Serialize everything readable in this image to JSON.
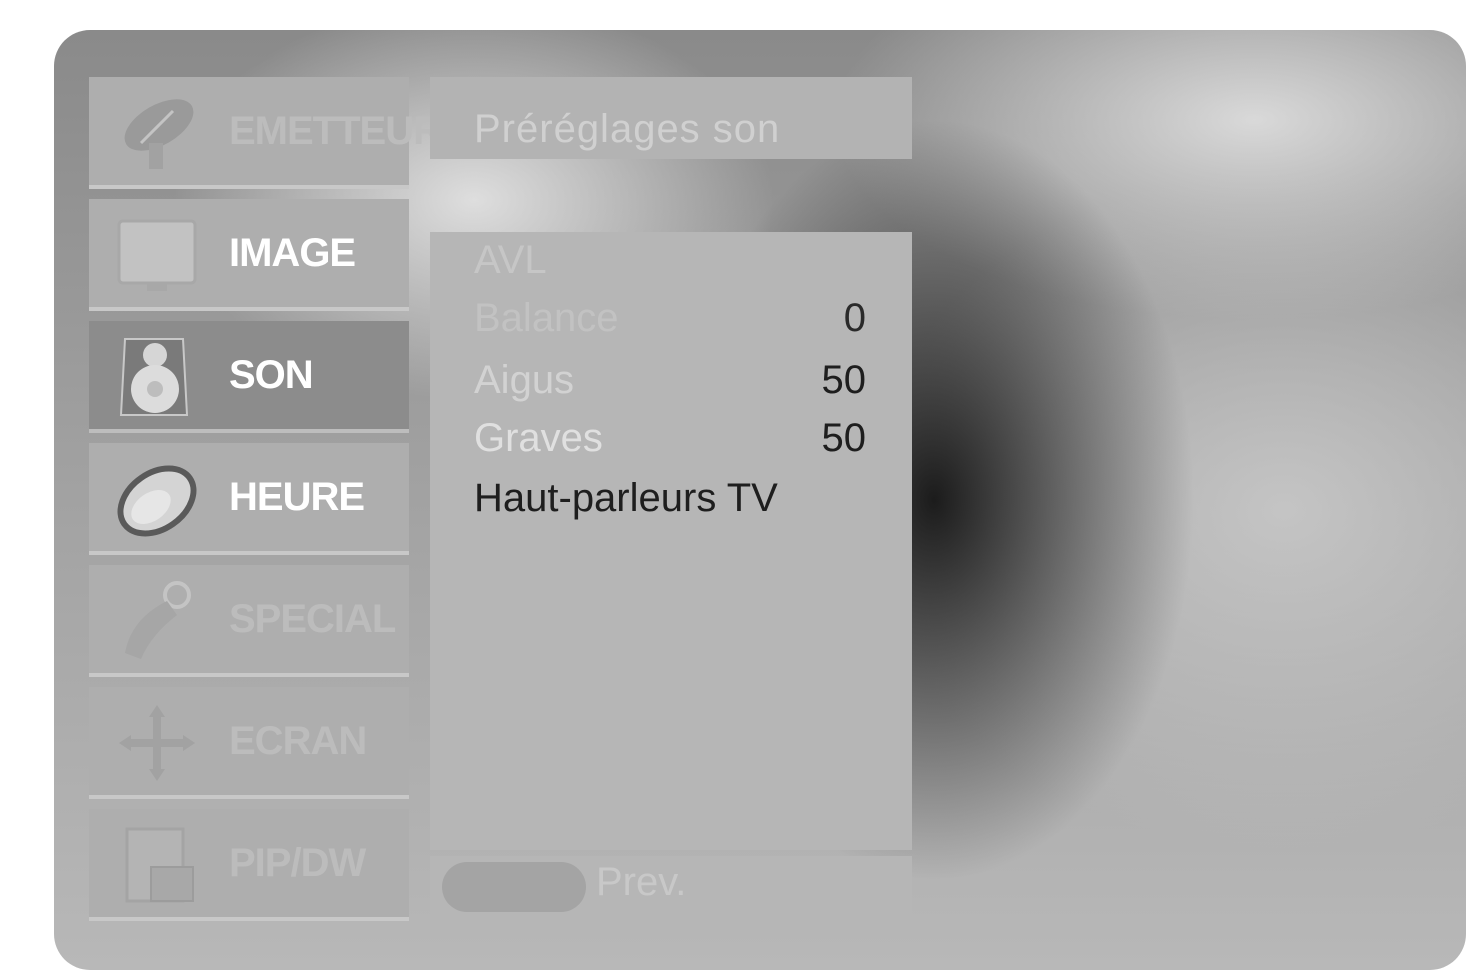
{
  "sidebar": {
    "items": [
      {
        "label": "EMETTEUR",
        "icon": "satellite-dish-icon",
        "state": "dim"
      },
      {
        "label": "IMAGE",
        "icon": "tv-screen-icon",
        "state": "normal"
      },
      {
        "label": "SON",
        "icon": "speaker-icon",
        "state": "selected"
      },
      {
        "label": "HEURE",
        "icon": "clock-icon",
        "state": "normal"
      },
      {
        "label": "SPECIAL",
        "icon": "special-icon",
        "state": "dim"
      },
      {
        "label": "ECRAN",
        "icon": "arrows-icon",
        "state": "dim"
      },
      {
        "label": "PIP/DW",
        "icon": "pip-icon",
        "state": "dim"
      }
    ]
  },
  "header": {
    "title": "Préréglages son"
  },
  "menu": {
    "rows": [
      {
        "label": "AVL",
        "value": ""
      },
      {
        "label": "Balance",
        "value": "0"
      },
      {
        "label": "Aigus",
        "value": "50"
      },
      {
        "label": "Graves",
        "value": "50"
      },
      {
        "label": "Haut-parleurs TV",
        "value": ""
      }
    ]
  },
  "footer": {
    "prev_label": "Prev."
  },
  "colors": {
    "selected_item": "#8c8c8c",
    "panel": "#b6b6b6",
    "text_bright": "#ffffff",
    "text_dark": "#1e1e1e"
  }
}
